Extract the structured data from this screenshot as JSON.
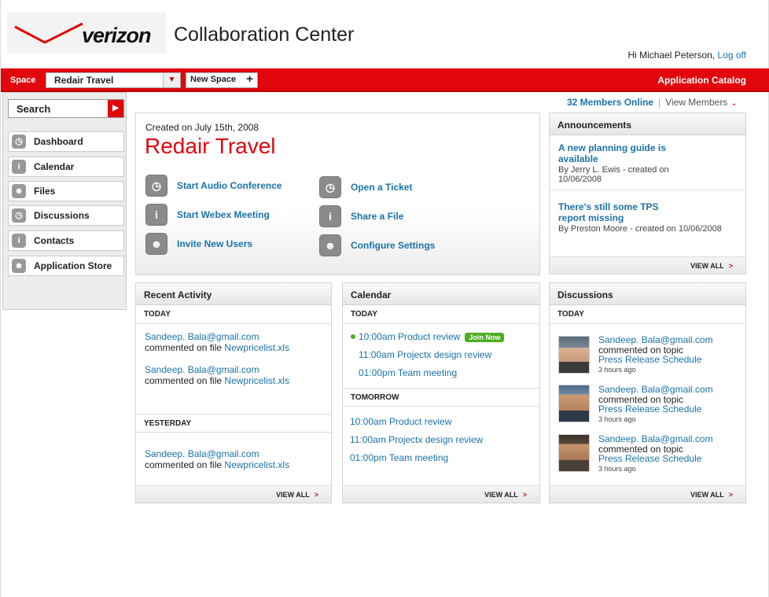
{
  "header": {
    "logo_text": "verizon",
    "app_title": "Collaboration Center",
    "greeting": "Hi Michael Peterson,",
    "logoff": "Log off"
  },
  "topbar": {
    "space_label": "Space",
    "space_selected": "Redair Travel",
    "new_space": "New Space",
    "app_catalog": "Application Catalog"
  },
  "sidebar": {
    "search_placeholder": "Search",
    "items": [
      {
        "label": "Dashboard",
        "icon": "clock-icon"
      },
      {
        "label": "Calendar",
        "icon": "info-icon"
      },
      {
        "label": "Files",
        "icon": "users-icon"
      },
      {
        "label": "Discussions",
        "icon": "clock-icon"
      },
      {
        "label": "Contacts",
        "icon": "info-icon"
      },
      {
        "label": "Application Store",
        "icon": "users-icon"
      }
    ]
  },
  "members": {
    "online": "32 Members Online",
    "view": "View Members"
  },
  "space": {
    "created": "Created on July 15th, 2008",
    "name": "Redair Travel",
    "actions": [
      {
        "label": "Start Audio Conference",
        "icon": "clock-icon"
      },
      {
        "label": "Start Webex Meeting",
        "icon": "info-icon"
      },
      {
        "label": "Invite New Users",
        "icon": "users-icon"
      },
      {
        "label": "Open a Ticket",
        "icon": "clock-icon"
      },
      {
        "label": "Share a File",
        "icon": "info-icon"
      },
      {
        "label": "Configure Settings",
        "icon": "users-icon"
      }
    ]
  },
  "announcements": {
    "title": "Announcements",
    "view_all": "VIEW ALL",
    "items": [
      {
        "title": "A new planning guide is available",
        "meta": "By Jerry L. Ewis - created on 10/06/2008"
      },
      {
        "title": "There's still some TPS report missing",
        "meta": "By Preston Moore - created on 10/06/2008"
      }
    ]
  },
  "recent_activity": {
    "title": "Recent Activity",
    "view_all": "VIEW ALL",
    "today_label": "TODAY",
    "yesterday_label": "YESTERDAY",
    "action": "commented on file",
    "items": [
      {
        "user": "Sandeep. Bala@gmail.com",
        "file": "Newpricelist.xls"
      },
      {
        "user": "Sandeep. Bala@gmail.com",
        "file": "Newpricelist.xls"
      },
      {
        "user": "Sandeep. Bala@gmail.com",
        "file": "Newpricelist.xls"
      }
    ]
  },
  "calendar": {
    "title": "Calendar",
    "view_all": "VIEW ALL",
    "today_label": "TODAY",
    "tomorrow_label": "TOMORROW",
    "join": "Join Now",
    "today": [
      "10:00am Product review",
      "11:00am Projectx design review",
      "01:00pm Team meeting"
    ],
    "tomorrow": [
      "10:00am Product review",
      "11:00am Projectx design review",
      "01:00pm Team meeting"
    ]
  },
  "discussions": {
    "title": "Discussions",
    "view_all": "VIEW ALL",
    "today_label": "TODAY",
    "action": "commented on topic",
    "items": [
      {
        "user": "Sandeep. Bala@gmail.com",
        "topic": "Press Release Schedule",
        "time": "3 hours ago"
      },
      {
        "user": "Sandeep. Bala@gmail.com",
        "topic": "Press Release Schedule",
        "time": "3 hours ago"
      },
      {
        "user": "Sandeep. Bala@gmail.com",
        "topic": "Press Release Schedule",
        "time": "3 hours ago"
      }
    ]
  },
  "colors": {
    "brand_red": "#e0060b",
    "link_blue": "#1a73a8",
    "live_green": "#4cad20"
  }
}
